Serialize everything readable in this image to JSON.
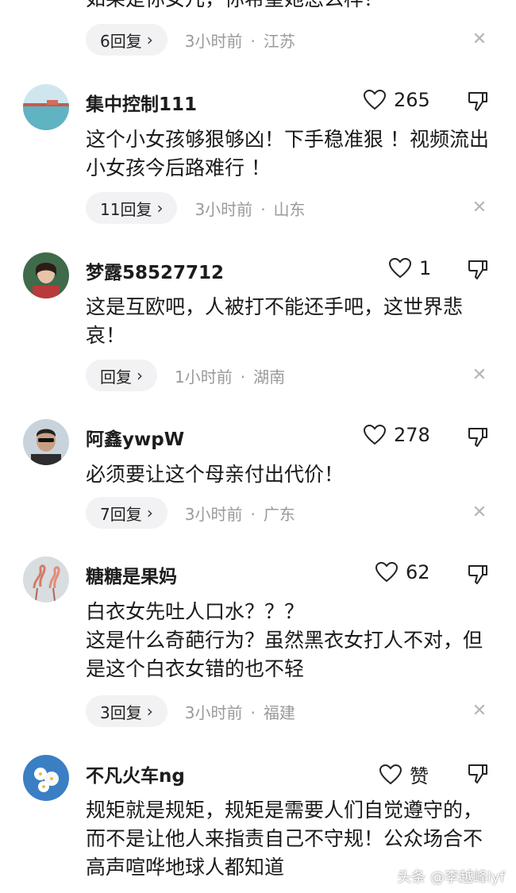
{
  "top_partial": {
    "text": "如果是你女儿，你希望她怎么样？",
    "reply_count": "6回复",
    "time": "3小时前",
    "location": "江苏"
  },
  "comments": [
    {
      "username": "集中控制111",
      "likes": "265",
      "text": "这个小女孩够狠够凶！下手稳准狠 ！视频流出小女孩今后路难行 ！",
      "reply_count": "11回复",
      "time": "3小时前",
      "location": "山东"
    },
    {
      "username": "梦露58527712",
      "likes": "1",
      "text": "这是互欧吧，人被打不能还手吧，这世界悲哀！",
      "reply_count": "回复",
      "time": "1小时前",
      "location": "湖南"
    },
    {
      "username": "阿鑫ywpW",
      "likes": "278",
      "text": "必须要让这个母亲付出代价！",
      "reply_count": "7回复",
      "time": "3小时前",
      "location": "广东"
    },
    {
      "username": "糖糖是果妈",
      "likes": "62",
      "text_line1": "白衣女先吐人口水？？？",
      "text_line2": "这是什么奇葩行为？虽然黑衣女打人不对，但是这个白衣女错的也不轻",
      "reply_count": "3回复",
      "time": "3小时前",
      "location": "福建"
    },
    {
      "username": "不凡火车ng",
      "likes": "赞",
      "text": "规矩就是规矩，规矩是需要人们自觉遵守的，而不是让他人来指责自己不守规！公众场合不高声喧哗地球人都知道"
    }
  ],
  "dot": "·",
  "chevron": "›",
  "close": "✕",
  "watermark": "头条 @李越峰lyf"
}
